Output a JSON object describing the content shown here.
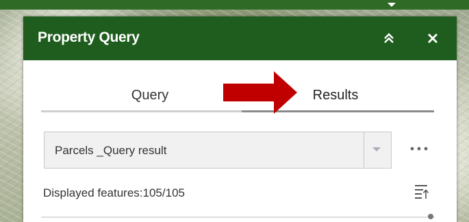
{
  "panel": {
    "title": "Property Query",
    "icons": {
      "collapse": "double-chevron-up-icon",
      "close": "close-icon"
    }
  },
  "tabs": [
    {
      "label": "Query",
      "active": false
    },
    {
      "label": "Results",
      "active": true
    }
  ],
  "annotation": {
    "icon": "red-arrow-icon",
    "color": "#c00000"
  },
  "result_select": {
    "value": "Parcels _Query result",
    "icon": "caret-down-icon"
  },
  "more_button": {
    "icon": "ellipsis-icon"
  },
  "features": {
    "label": "Displayed features:105/105",
    "icon": "sort-icon"
  },
  "colors": {
    "header": "#1f5d1f",
    "header_text": "#ffffff",
    "arrow": "#c00000"
  }
}
